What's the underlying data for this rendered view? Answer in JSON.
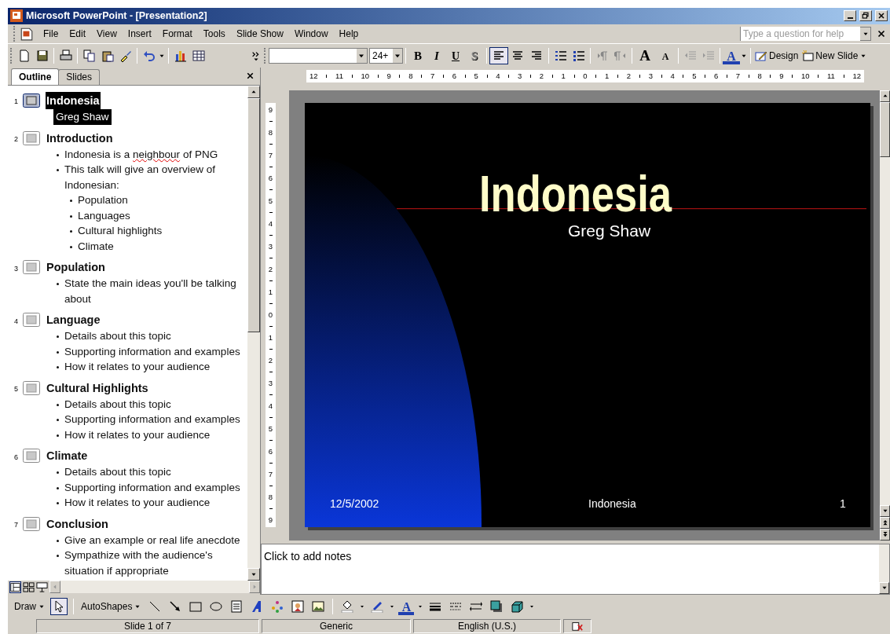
{
  "window": {
    "title": "Microsoft PowerPoint - [Presentation2]"
  },
  "menu": [
    {
      "label": "File"
    },
    {
      "label": "Edit"
    },
    {
      "label": "View"
    },
    {
      "label": "Insert"
    },
    {
      "label": "Format"
    },
    {
      "label": "Tools"
    },
    {
      "label": "Slide Show"
    },
    {
      "label": "Window"
    },
    {
      "label": "Help"
    }
  ],
  "help_search": {
    "placeholder": "Type a question for help"
  },
  "formatting": {
    "font_size": "24+",
    "style_buttons": [
      {
        "label": "B",
        "kind": "bold"
      },
      {
        "label": "I",
        "kind": "italic"
      },
      {
        "label": "U",
        "kind": "underline"
      },
      {
        "label": "S",
        "kind": "shadow"
      }
    ],
    "align_buttons": [
      {
        "kind": "left",
        "selected": true
      },
      {
        "kind": "center",
        "selected": false
      },
      {
        "kind": "right",
        "selected": false
      }
    ],
    "size_buttons": [
      {
        "label": "A",
        "kind": "grow"
      },
      {
        "label": "A",
        "kind": "shrink"
      }
    ],
    "font_color": "A",
    "task_buttons": [
      {
        "label": "Design",
        "kind": "design"
      },
      {
        "label": "New Slide",
        "kind": "new_slide"
      }
    ]
  },
  "pane_tabs": [
    {
      "label": "Outline",
      "selected": true
    },
    {
      "label": "Slides",
      "selected": false
    }
  ],
  "ruler": {
    "horizontal": [
      "12",
      "11",
      "10",
      "9",
      "8",
      "7",
      "6",
      "5",
      "4",
      "3",
      "2",
      "1",
      "0",
      "1",
      "2",
      "3",
      "4",
      "5",
      "6",
      "7",
      "8",
      "9",
      "10",
      "11",
      "12"
    ],
    "vertical": [
      "9",
      "8",
      "7",
      "6",
      "5",
      "4",
      "3",
      "2",
      "1",
      "0",
      "1",
      "2",
      "3",
      "4",
      "5",
      "6",
      "7",
      "8",
      "9"
    ]
  },
  "outline": [
    {
      "number": "1",
      "title": "Indonesia",
      "selected": true,
      "lines": [
        {
          "kind": "subtitle",
          "text": "Greg Shaw"
        }
      ]
    },
    {
      "number": "2",
      "title": "Introduction",
      "selected": false,
      "lines": [
        {
          "kind": "bullet",
          "parts": [
            {
              "text": "Indonesia is a "
            },
            {
              "text": "neighbour",
              "misspelled": true
            },
            {
              "text": " of PNG"
            }
          ]
        },
        {
          "kind": "bullet",
          "text": "This talk will give an overview of Indonesian:",
          "children": [
            {
              "text": "Population"
            },
            {
              "text": "Languages"
            },
            {
              "text": "Cultural highlights"
            },
            {
              "text": "Climate"
            }
          ]
        }
      ]
    },
    {
      "number": "3",
      "title": "Population",
      "selected": false,
      "lines": [
        {
          "kind": "bullet",
          "text": "State the main ideas you'll be talking about"
        }
      ]
    },
    {
      "number": "4",
      "title": "Language",
      "selected": false,
      "lines": [
        {
          "kind": "bullet",
          "text": "Details about this topic"
        },
        {
          "kind": "bullet",
          "text": "Supporting information and examples"
        },
        {
          "kind": "bullet",
          "text": "How it relates to your audience"
        }
      ]
    },
    {
      "number": "5",
      "title": "Cultural Highlights",
      "selected": false,
      "lines": [
        {
          "kind": "bullet",
          "text": "Details about this topic"
        },
        {
          "kind": "bullet",
          "text": "Supporting information and examples"
        },
        {
          "kind": "bullet",
          "text": "How it relates to your audience"
        }
      ]
    },
    {
      "number": "6",
      "title": "Climate",
      "selected": false,
      "lines": [
        {
          "kind": "bullet",
          "text": "Details about this topic"
        },
        {
          "kind": "bullet",
          "text": "Supporting information and examples"
        },
        {
          "kind": "bullet",
          "text": "How it relates to your audience"
        }
      ]
    },
    {
      "number": "7",
      "title": "Conclusion",
      "selected": false,
      "lines": [
        {
          "kind": "bullet",
          "text": "Give an example or real life anecdote"
        },
        {
          "kind": "bullet",
          "text": "Sympathize with the audience's situation if appropriate"
        }
      ]
    }
  ],
  "slide": {
    "title": "Indonesia",
    "subtitle": "Greg Shaw",
    "date": "12/5/2002",
    "footer": "Indonesia",
    "number": "1"
  },
  "notes": {
    "prompt": "Click to add notes"
  },
  "drawing_toolbar": {
    "draw": "Draw",
    "autoshapes": "AutoShapes",
    "font_color": "A"
  },
  "status_bar": [
    "Slide 1 of 7",
    "Generic",
    "English (U.S.)"
  ]
}
